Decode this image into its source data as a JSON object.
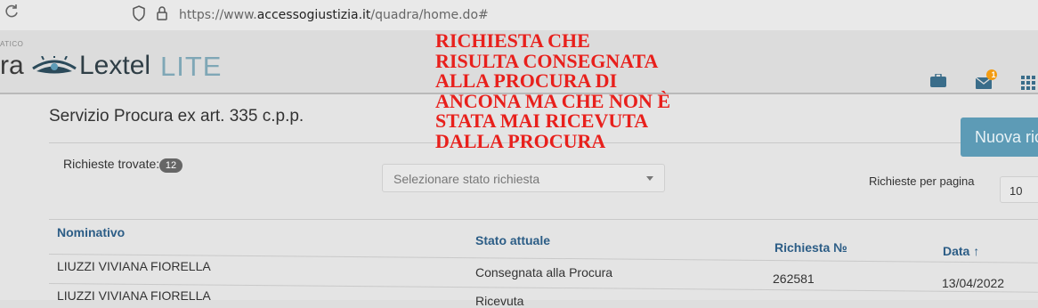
{
  "browser": {
    "url_prefix": "https://www.",
    "url_host": "accessogiustizia.it",
    "url_path": "/quadra/home.do#"
  },
  "header": {
    "tagline_fragment": "ATICO",
    "brand_fragment": "ra",
    "brand_name": "Lextel",
    "brand_suffix": "LITE",
    "notification_count": "1"
  },
  "annotation": {
    "lines": [
      "RICHIESTA CHE",
      "RISULTA CONSEGNATA",
      "ALLA PROCURA DI",
      "ANCONA MA CHE NON È",
      "STATA MAI RICEVUTA",
      "DALLA PROCURA"
    ],
    "color": "#e8201c"
  },
  "main": {
    "service_title": "Servizio Procura ex art. 335 c.p.p.",
    "new_button": "Nuova ric",
    "found_label": "Richieste trovate:",
    "found_count": "12",
    "status_placeholder": "Selezionare stato richiesta",
    "per_page_label": "Richieste per pagina",
    "per_page_value": "10"
  },
  "table": {
    "headers": [
      "Nominativo",
      "Stato attuale",
      "Richiesta №",
      "Data"
    ],
    "sort_indicator": "↑",
    "rows": [
      {
        "nominativo": "LIUZZI VIVIANA FIORELLA",
        "stato": "Consegnata alla Procura",
        "richiesta": "262581",
        "data": "13/04/2022"
      },
      {
        "nominativo": "LIUZZI VIVIANA FIORELLA",
        "stato": "Ricevuta",
        "richiesta": "",
        "data": ""
      }
    ]
  },
  "colors": {
    "accent": "#5d9bb6",
    "header_text": "#2c5d86",
    "annotation": "#e8201c"
  }
}
